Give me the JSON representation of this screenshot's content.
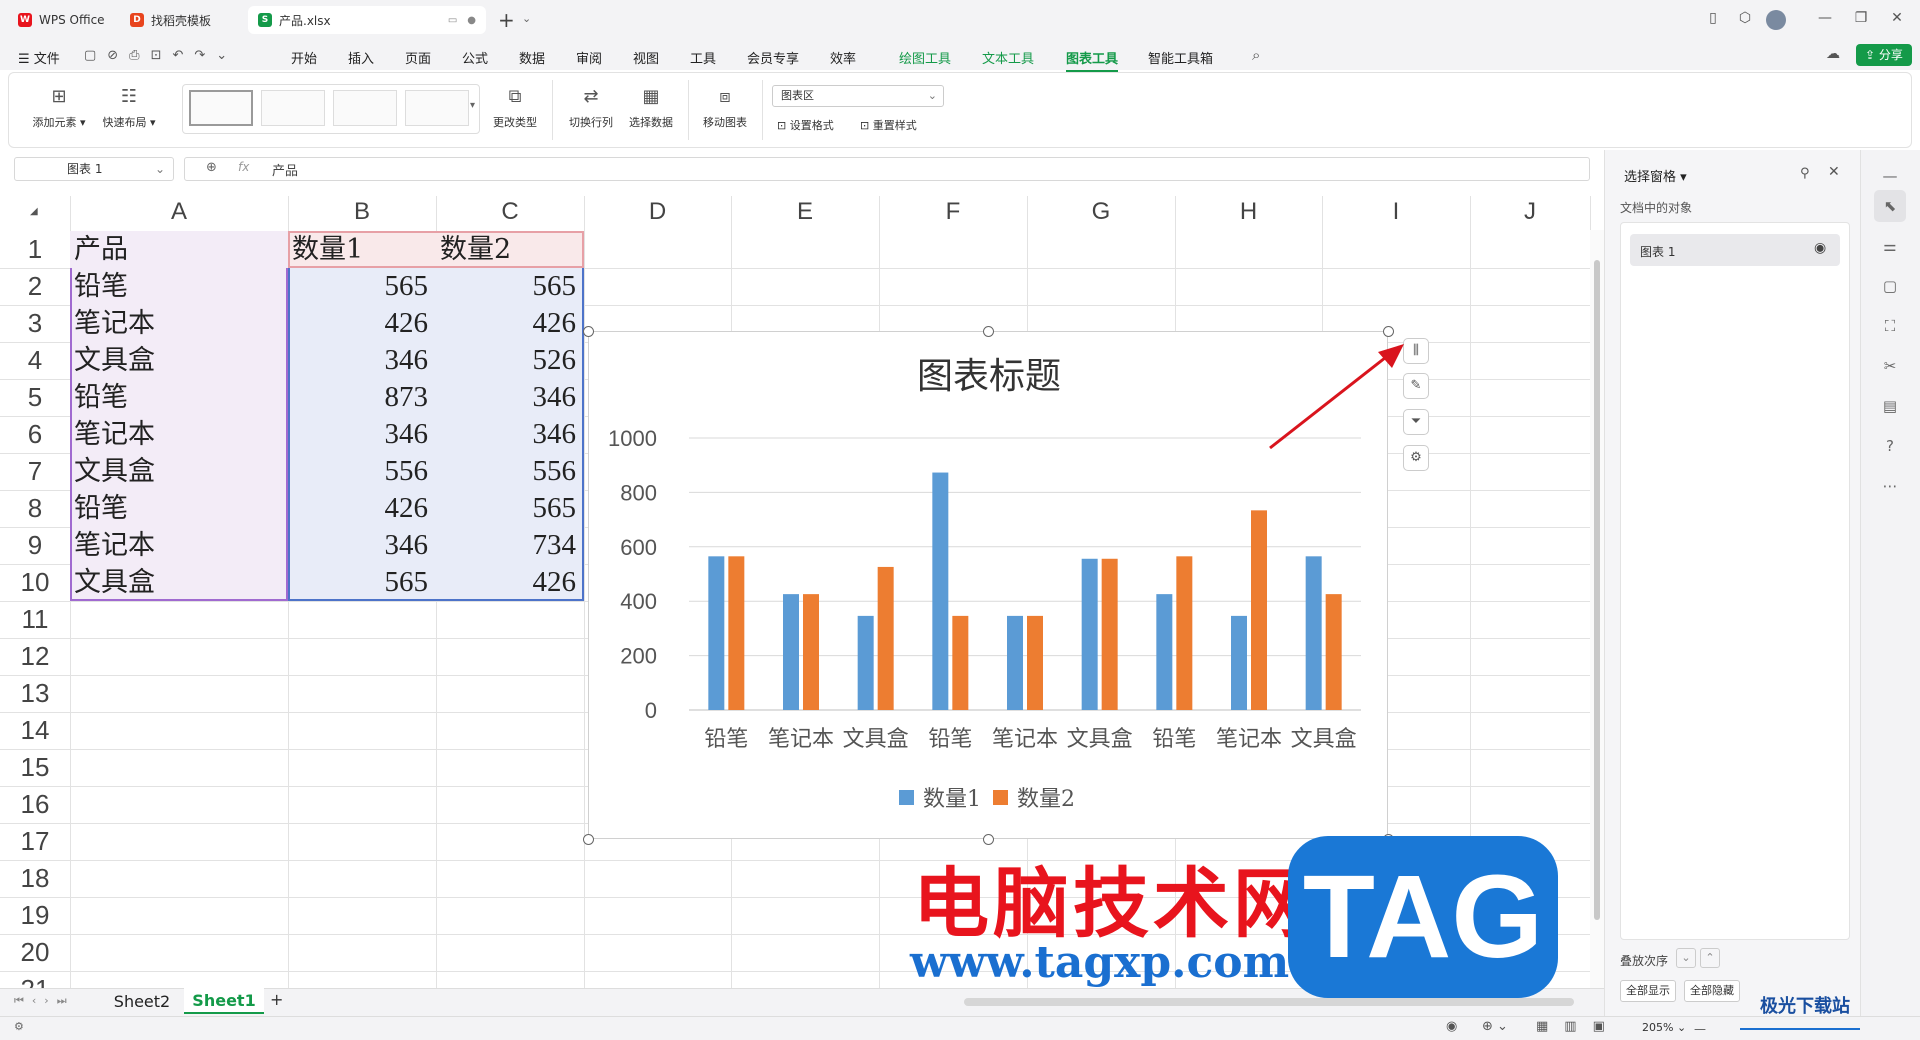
{
  "window": {
    "tabs": [
      {
        "label": "WPS Office",
        "icon": "wps-logo-icon"
      },
      {
        "label": "找稻壳模板",
        "icon": "docer-icon"
      },
      {
        "label": "产品.xlsx",
        "icon": "spreadsheet-s-icon"
      }
    ]
  },
  "menu": {
    "file": "文件",
    "items": [
      "开始",
      "插入",
      "页面",
      "公式",
      "数据",
      "审阅",
      "视图",
      "工具",
      "会员专享",
      "效率",
      "绘图工具",
      "文本工具",
      "图表工具",
      "智能工具箱"
    ],
    "active": "图表工具",
    "share": "分享"
  },
  "ribbon": {
    "add_element": "添加元素",
    "quick_layout": "快速布局",
    "change_type": "更改类型",
    "switch_rowcol": "切换行列",
    "select_data": "选择数据",
    "move_chart": "移动图表",
    "chart_area_select": "图表区",
    "set_format": "设置格式",
    "reset_style": "重置样式"
  },
  "formula_bar": {
    "name_box": "图表 1",
    "fx": "fx",
    "content": "产品"
  },
  "grid": {
    "columns": [
      "A",
      "B",
      "C",
      "D",
      "E",
      "F",
      "G",
      "H",
      "I",
      "J"
    ],
    "rows": [
      "1",
      "2",
      "3",
      "4",
      "5",
      "6",
      "7",
      "8",
      "9",
      "10",
      "11",
      "12",
      "13",
      "14",
      "15",
      "16",
      "17",
      "18",
      "19",
      "20",
      "21"
    ],
    "header": [
      "产品",
      "数量1",
      "数量2"
    ],
    "data": [
      [
        "铅笔",
        "565",
        "565"
      ],
      [
        "笔记本",
        "426",
        "426"
      ],
      [
        "文具盒",
        "346",
        "526"
      ],
      [
        "铅笔",
        "873",
        "346"
      ],
      [
        "笔记本",
        "346",
        "346"
      ],
      [
        "文具盒",
        "556",
        "556"
      ],
      [
        "铅笔",
        "426",
        "565"
      ],
      [
        "笔记本",
        "346",
        "734"
      ],
      [
        "文具盒",
        "565",
        "426"
      ]
    ]
  },
  "chart_data": {
    "type": "bar",
    "title": "图表标题",
    "categories": [
      "铅笔",
      "笔记本",
      "文具盒",
      "铅笔",
      "笔记本",
      "文具盒",
      "铅笔",
      "笔记本",
      "文具盒"
    ],
    "series": [
      {
        "name": "数量1",
        "values": [
          565,
          426,
          346,
          873,
          346,
          556,
          426,
          346,
          565
        ],
        "color": "#5b9bd5"
      },
      {
        "name": "数量2",
        "values": [
          565,
          426,
          526,
          346,
          346,
          556,
          565,
          734,
          426
        ],
        "color": "#ed7d31"
      }
    ],
    "yticks": [
      "0",
      "200",
      "400",
      "600",
      "800",
      "1000"
    ],
    "ylim": [
      0,
      1000
    ],
    "grid": true,
    "legend": "bottom"
  },
  "right_panel": {
    "title": "选择窗格",
    "subtitle": "文档中的对象",
    "object": "图表 1",
    "order_label": "叠放次序",
    "show_all": "全部显示",
    "hide_all": "全部隐藏"
  },
  "sheets": {
    "tabs": [
      "Sheet2",
      "Sheet1"
    ],
    "active": "Sheet1",
    "add": "+"
  },
  "status": {
    "zoom": "205%"
  },
  "watermark": {
    "cn": "电脑技术网",
    "url": "www.tagxp.com",
    "tag": "TAG",
    "corner": "极光下载站"
  },
  "colors": {
    "accent": "#149a49",
    "blue_selection": "#e8ecf8",
    "pink_header": "#f9e9ea",
    "purple_selection": "#f3ecf7"
  }
}
